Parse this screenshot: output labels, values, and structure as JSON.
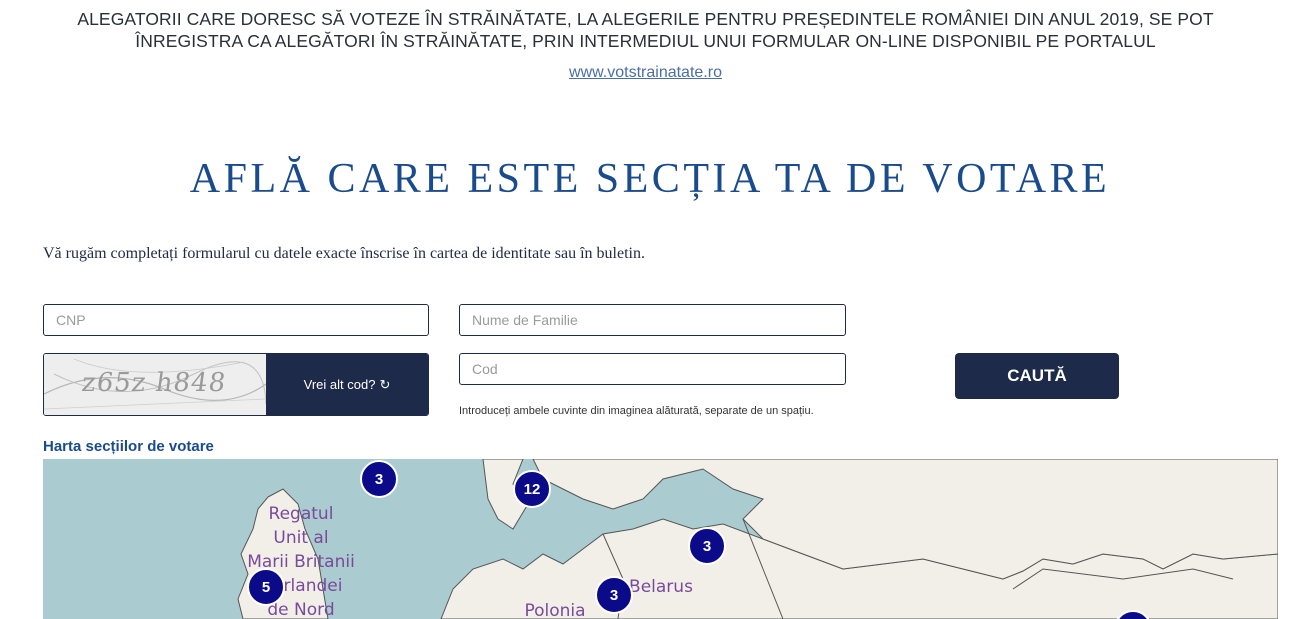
{
  "notice": {
    "text": "ALEGATORII CARE DORESC SĂ VOTEZE ÎN STRĂINĂTATE, LA ALEGERILE PENTRU PREȘEDINTELE ROMÂNIEI DIN ANUL 2019, SE POT ÎNREGISTRA CA ALEGĂTORI ÎN STRĂINĂTATE, PRIN INTERMEDIUL UNUI FORMULAR ON-LINE DISPONIBIL PE PORTALUL",
    "link": "www.votstrainatate.ro"
  },
  "title": "AFLĂ CARE ESTE SECȚIA TA DE VOTARE",
  "instructions": "Vă rugăm completați formularul cu datele exacte înscrise în cartea de identitate sau în buletin.",
  "form": {
    "cnp_placeholder": "CNP",
    "nume_placeholder": "Nume de Familie",
    "cod_placeholder": "Cod",
    "captcha_text": "z65z   h848",
    "refresh_label": "Vrei alt cod?",
    "hint": "Introduceți ambele cuvinte din imaginea alăturată, separate de un spațiu.",
    "search_label": "CAUTĂ"
  },
  "map": {
    "label": "Harta secțiilor de votare",
    "countries": [
      {
        "name": "Regatul"
      },
      {
        "name": "Unit al"
      },
      {
        "name": "Marii Britanii"
      },
      {
        "name": "și Irlandei"
      },
      {
        "name": "de Nord"
      },
      {
        "name": "Belarus"
      },
      {
        "name": "Polonia"
      }
    ],
    "clusters": [
      "3",
      "12",
      "3",
      "5",
      "3"
    ],
    "colors": {
      "sea": "#aacbcf",
      "land": "#f2efe9",
      "cluster": "#0b0b8a"
    }
  }
}
